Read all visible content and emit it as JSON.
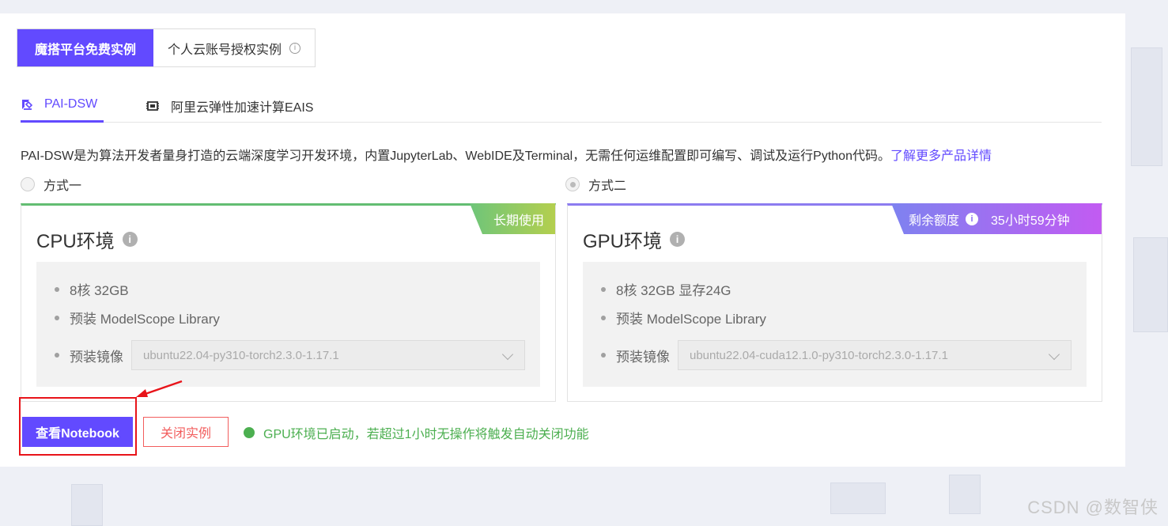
{
  "mode_tabs": {
    "free": "魔搭平台免费实例",
    "personal": "个人云账号授权实例"
  },
  "product_tabs": {
    "pai_dsw": "PAI-DSW",
    "eais": "阿里云弹性加速计算EAIS"
  },
  "description": {
    "text": "PAI-DSW是为算法开发者量身打造的云端深度学习开发环境，内置JupyterLab、WebIDE及Terminal，无需任何运维配置即可编写、调试及运行Python代码。",
    "link": "了解更多产品详情"
  },
  "options": {
    "option1": "方式一",
    "option2": "方式二"
  },
  "cpu_env": {
    "title": "CPU环境",
    "badge": "长期使用",
    "spec1": "8核 32GB",
    "spec2": "预装 ModelScope Library",
    "image_label": "预装镜像",
    "image_value": "ubuntu22.04-py310-torch2.3.0-1.17.1"
  },
  "gpu_env": {
    "title": "GPU环境",
    "badge_label": "剩余额度",
    "badge_value": "35小时59分钟",
    "spec1": "8核 32GB 显存24G",
    "spec2": "预装 ModelScope Library",
    "image_label": "预装镜像",
    "image_value": "ubuntu22.04-cuda12.1.0-py310-torch2.3.0-1.17.1"
  },
  "actions": {
    "view_notebook": "查看Notebook",
    "close_instance": "关闭实例",
    "status": "GPU环境已启动，若超过1小时无操作将触发自动关闭功能"
  },
  "watermark": "CSDN @数智侠",
  "colors": {
    "primary": "#624aff",
    "success": "#4caf50",
    "danger": "#f25d5d",
    "highlight": "#e8141a"
  }
}
